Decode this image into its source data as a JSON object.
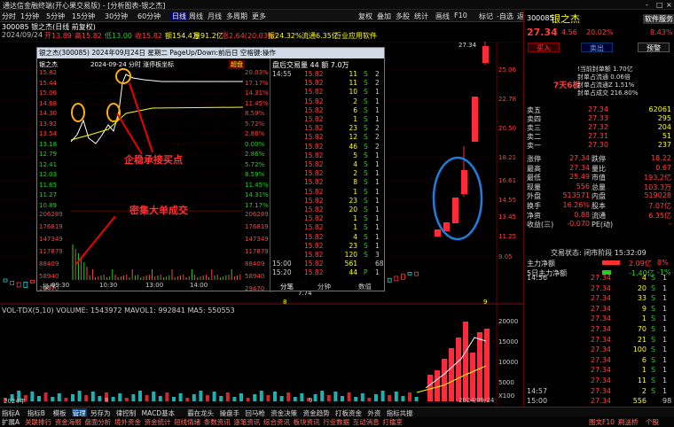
{
  "window": {
    "title": "通达信金融终端(开心果交易版) - [分析图表-银之杰]",
    "controls": [
      "-",
      "□",
      "×"
    ]
  },
  "menubar": {
    "items": [
      "分时",
      "1分钟",
      "5分钟",
      "15分钟",
      "30分钟",
      "60分钟",
      "日线",
      "周线",
      "月线",
      "多周期",
      "更多"
    ],
    "active": "日线",
    "right_items": [
      "复权",
      "叠加",
      "多股",
      "统计",
      "画线",
      "F10",
      "标记",
      "-自选",
      "返回"
    ]
  },
  "infobar": {
    "code_name": "300085 银之杰(日线 前复权)",
    "date": "2024/09/24",
    "open": "开13.89",
    "high": "高15.82",
    "low": "低13.00",
    "close": "收15.82",
    "amount": "额154.4万",
    "volume": "量91.2亿",
    "change": "涨2.64(20.03%)",
    "amplitude": "振24.32%",
    "turnover": "流通6.35亿",
    "industry": "行业应用软件"
  },
  "price_axis": [
    "25.06",
    "22.78",
    "20.50",
    "18.21",
    "16.61",
    "14.55",
    "13.45",
    "11.25",
    "9.05",
    "7.75"
  ],
  "peak_label": "27.34",
  "low_label": "7.74",
  "date_labels": [
    "2024年",
    "8",
    "9",
    "2024/09/24"
  ],
  "volume_panel": {
    "header": "VOL-TDX(5,10)  VOLUME: 1543972  MAVOL1: 992841  MA5: 550553",
    "axis": [
      "20000",
      "15000",
      "10000",
      "5000",
      "X100"
    ]
  },
  "popup": {
    "title": "银之杰(300085) 2024年09月24日 星期二 PageUp/Down:前后日 空格键:操作",
    "inner_label": "2024-09-24 分时  涨停板坐标",
    "stock": "银之杰",
    "super_label": "超盘",
    "left_axis": [
      "15.82",
      "15.44",
      "15.06",
      "14.68",
      "14.30",
      "13.92",
      "13.54",
      "13.18",
      "12.79",
      "12.41",
      "12.03",
      "11.65",
      "11.27",
      "10.89"
    ],
    "right_axis": [
      "20.03%",
      "17.17%",
      "14.31%",
      "11.45%",
      "8.59%",
      "5.72%",
      "2.86%",
      "0.00%",
      "2.86%",
      "5.72%",
      "8.59%",
      "11.45%",
      "14.31%",
      "17.17%"
    ],
    "vol_axis": [
      "206289",
      "176819",
      "147349",
      "117879",
      "88409",
      "58940",
      "29470"
    ],
    "time_axis": [
      "09:30",
      "10:30",
      "13:00",
      "14:00"
    ],
    "annotations": [
      "企稳承接买点",
      "密集大单成交"
    ],
    "trade_header": "盘后交易量 44 额 7.0万",
    "trades": [
      {
        "t": "14:55",
        "p": "15.82",
        "v": "11",
        "f": "S",
        "n": "2"
      },
      {
        "t": "",
        "p": "15.82",
        "v": "11",
        "f": "S",
        "n": "2"
      },
      {
        "t": "",
        "p": "15.82",
        "v": "10",
        "f": "S",
        "n": "1"
      },
      {
        "t": "",
        "p": "15.82",
        "v": "2",
        "f": "S",
        "n": "1"
      },
      {
        "t": "",
        "p": "15.82",
        "v": "6",
        "f": "S",
        "n": "1"
      },
      {
        "t": "",
        "p": "15.82",
        "v": "1",
        "f": "S",
        "n": "1"
      },
      {
        "t": "",
        "p": "15.82",
        "v": "23",
        "f": "S",
        "n": "2"
      },
      {
        "t": "",
        "p": "15.82",
        "v": "12",
        "f": "S",
        "n": "2"
      },
      {
        "t": "",
        "p": "15.82",
        "v": "46",
        "f": "S",
        "n": "2"
      },
      {
        "t": "",
        "p": "15.82",
        "v": "5",
        "f": "S",
        "n": "1"
      },
      {
        "t": "",
        "p": "15.82",
        "v": "4",
        "f": "S",
        "n": "1"
      },
      {
        "t": "",
        "p": "15.82",
        "v": "2",
        "f": "S",
        "n": "1"
      },
      {
        "t": "",
        "p": "15.82",
        "v": "8",
        "f": "S",
        "n": "1"
      },
      {
        "t": "",
        "p": "15.82",
        "v": "1",
        "f": "S",
        "n": "1"
      },
      {
        "t": "",
        "p": "15.82",
        "v": "23",
        "f": "S",
        "n": "1"
      },
      {
        "t": "",
        "p": "15.82",
        "v": "20",
        "f": "S",
        "n": "1"
      },
      {
        "t": "",
        "p": "15.82",
        "v": "1",
        "f": "S",
        "n": "1"
      },
      {
        "t": "",
        "p": "15.82",
        "v": "1",
        "f": "S",
        "n": "1"
      },
      {
        "t": "",
        "p": "15.82",
        "v": "4",
        "f": "S",
        "n": "1"
      },
      {
        "t": "",
        "p": "15.82",
        "v": "23",
        "f": "S",
        "n": "1"
      },
      {
        "t": "",
        "p": "15.82",
        "v": "120",
        "f": "S",
        "n": "3"
      },
      {
        "t": "15:00",
        "p": "15.82",
        "v": "561",
        "f": "",
        "n": "68"
      },
      {
        "t": "15:20",
        "p": "15.82",
        "v": "44",
        "f": "P",
        "n": "1"
      }
    ],
    "tabs": [
      "操作",
      "分笔",
      "分钟",
      "数值"
    ]
  },
  "right_panel": {
    "code": "300085",
    "name": "银之杰",
    "badge": "软件服务",
    "price": "27.34",
    "change": "4.56",
    "pct": "20.02%",
    "rate": "8.43%",
    "buttons": [
      "买入",
      "卖出",
      "预警"
    ],
    "badge2": "7天6板",
    "summary": [
      "!当前封单额 1.70亿",
      "封单占流通 0.06倍",
      "封单占流通Z 1.51%",
      "封单占成交 216.80%"
    ],
    "ask": [
      {
        "n": "卖五",
        "p": "27.34",
        "v": "62061"
      },
      {
        "n": "卖四",
        "p": "27.33",
        "v": "295"
      },
      {
        "n": "卖三",
        "p": "27.32",
        "v": "204"
      },
      {
        "n": "卖二",
        "p": "27.31",
        "v": "51"
      },
      {
        "n": "卖一",
        "p": "27.30",
        "v": "237"
      }
    ],
    "bid_label": "买一",
    "stats": [
      {
        "a": "涨停",
        "av": "27.34",
        "b": "跌停",
        "bv": "18.22"
      },
      {
        "a": "最高",
        "av": "27.34",
        "b": "量比",
        "bv": "0.67"
      },
      {
        "a": "最低",
        "av": "25.49",
        "b": "市值",
        "bv": "193.2亿"
      },
      {
        "a": "现量",
        "av": "556",
        "b": "总量",
        "bv": "103.3万"
      },
      {
        "a": "外盘",
        "av": "513571",
        "b": "内盘",
        "bv": "519028"
      },
      {
        "a": "换手",
        "av": "16.26%",
        "b": "股本",
        "bv": "7.07亿"
      },
      {
        "a": "净资",
        "av": "0.88",
        "b": "流通",
        "bv": "6.35亿"
      },
      {
        "a": "收益(三)",
        "av": "-0.070",
        "b": "PE(动)",
        "bv": "-"
      }
    ],
    "trade_state": "交易状态: 闭市阶段 15:32:09",
    "flows": [
      {
        "n": "主力净额",
        "v": "2.09亿",
        "p": "8%"
      },
      {
        "n": "5日主力净额",
        "v": "-1.40亿",
        "p": "-1%"
      }
    ],
    "ticks": [
      {
        "t": "14:56",
        "p": "27.34",
        "v": "4",
        "f": "S",
        "n": "1"
      },
      {
        "t": "",
        "p": "27.34",
        "v": "20",
        "f": "S",
        "n": "1"
      },
      {
        "t": "",
        "p": "27.34",
        "v": "33",
        "f": "S",
        "n": "1"
      },
      {
        "t": "",
        "p": "27.34",
        "v": "9",
        "f": "S",
        "n": "1"
      },
      {
        "t": "",
        "p": "27.34",
        "v": "1",
        "f": "S",
        "n": "1"
      },
      {
        "t": "",
        "p": "27.34",
        "v": "70",
        "f": "S",
        "n": "1"
      },
      {
        "t": "",
        "p": "27.34",
        "v": "21",
        "f": "S",
        "n": "1"
      },
      {
        "t": "",
        "p": "27.34",
        "v": "100",
        "f": "S",
        "n": "1"
      },
      {
        "t": "",
        "p": "27.34",
        "v": "6",
        "f": "S",
        "n": "1"
      },
      {
        "t": "",
        "p": "27.34",
        "v": "1",
        "f": "S",
        "n": "1"
      },
      {
        "t": "",
        "p": "27.34",
        "v": "11",
        "f": "S",
        "n": "1"
      },
      {
        "t": "14:57",
        "p": "27.34",
        "v": "2",
        "f": "S",
        "n": "1"
      },
      {
        "t": "15:00",
        "p": "27.34",
        "v": "556",
        "f": "",
        "n": "98"
      }
    ]
  },
  "bottom_tabs": [
    "指标A",
    "指标B",
    "模板",
    "管理",
    "另存为",
    "律控制",
    "MACD基本",
    "霸在龙头",
    "操盘手",
    "回马枪",
    "资金决策",
    "资金趋势",
    "打板资金",
    "外资",
    "指标共振"
  ],
  "bottom_active": "管理",
  "status_items": [
    "扩展A",
    "关联排行",
    "资金海报",
    "盘面分析",
    "境外资金",
    "资金统计",
    "短线情绪",
    "条数资讯",
    "逐笔资讯",
    "综合资讯",
    "板块资讯",
    "行业数据",
    "互动消息",
    "打擂室"
  ],
  "status_right": [
    "图文F10",
    "刷送桥",
    "个股"
  ]
}
